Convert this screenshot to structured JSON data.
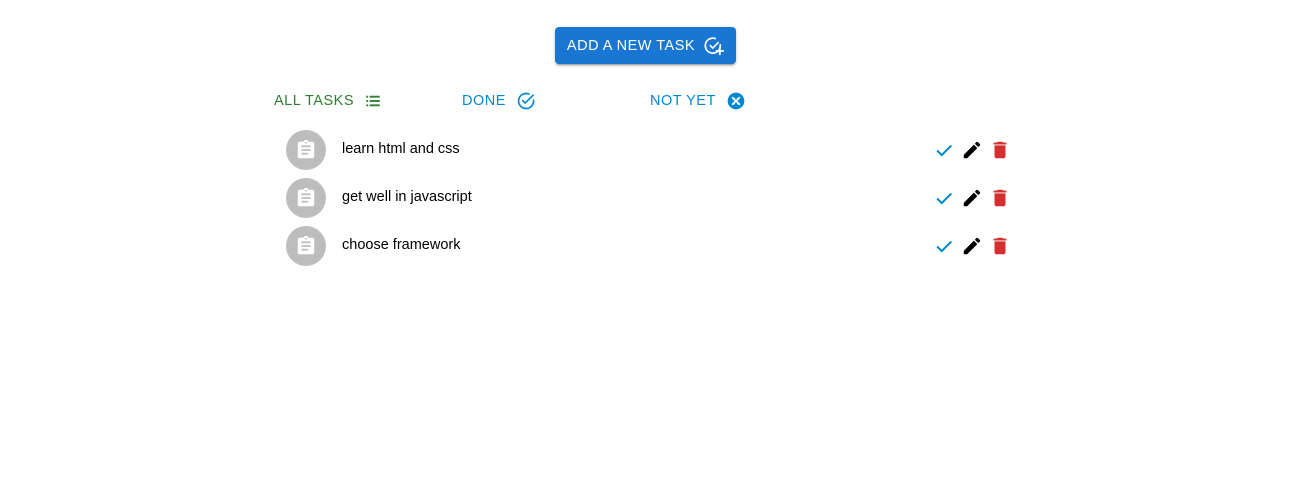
{
  "toolbar": {
    "add_label": "ADD A NEW TASK"
  },
  "filters": {
    "all": "ALL TASKS",
    "done": "DONE",
    "not_yet": "NOT YET"
  },
  "tasks": [
    {
      "text": "learn html and css"
    },
    {
      "text": "get well in javascript"
    },
    {
      "text": "choose framework"
    }
  ],
  "colors": {
    "primary": "#1976d2",
    "success": "#2e7d32",
    "info": "#0288d1",
    "error": "#d32f2f",
    "avatar": "#bdbdbd"
  },
  "icons": {
    "add": "add-task-icon",
    "all": "list-icon",
    "done": "check-circle-outline-icon",
    "not_yet": "cancel-icon",
    "avatar": "clipboard-icon",
    "complete": "check-icon",
    "edit": "pencil-icon",
    "delete": "trash-icon"
  }
}
